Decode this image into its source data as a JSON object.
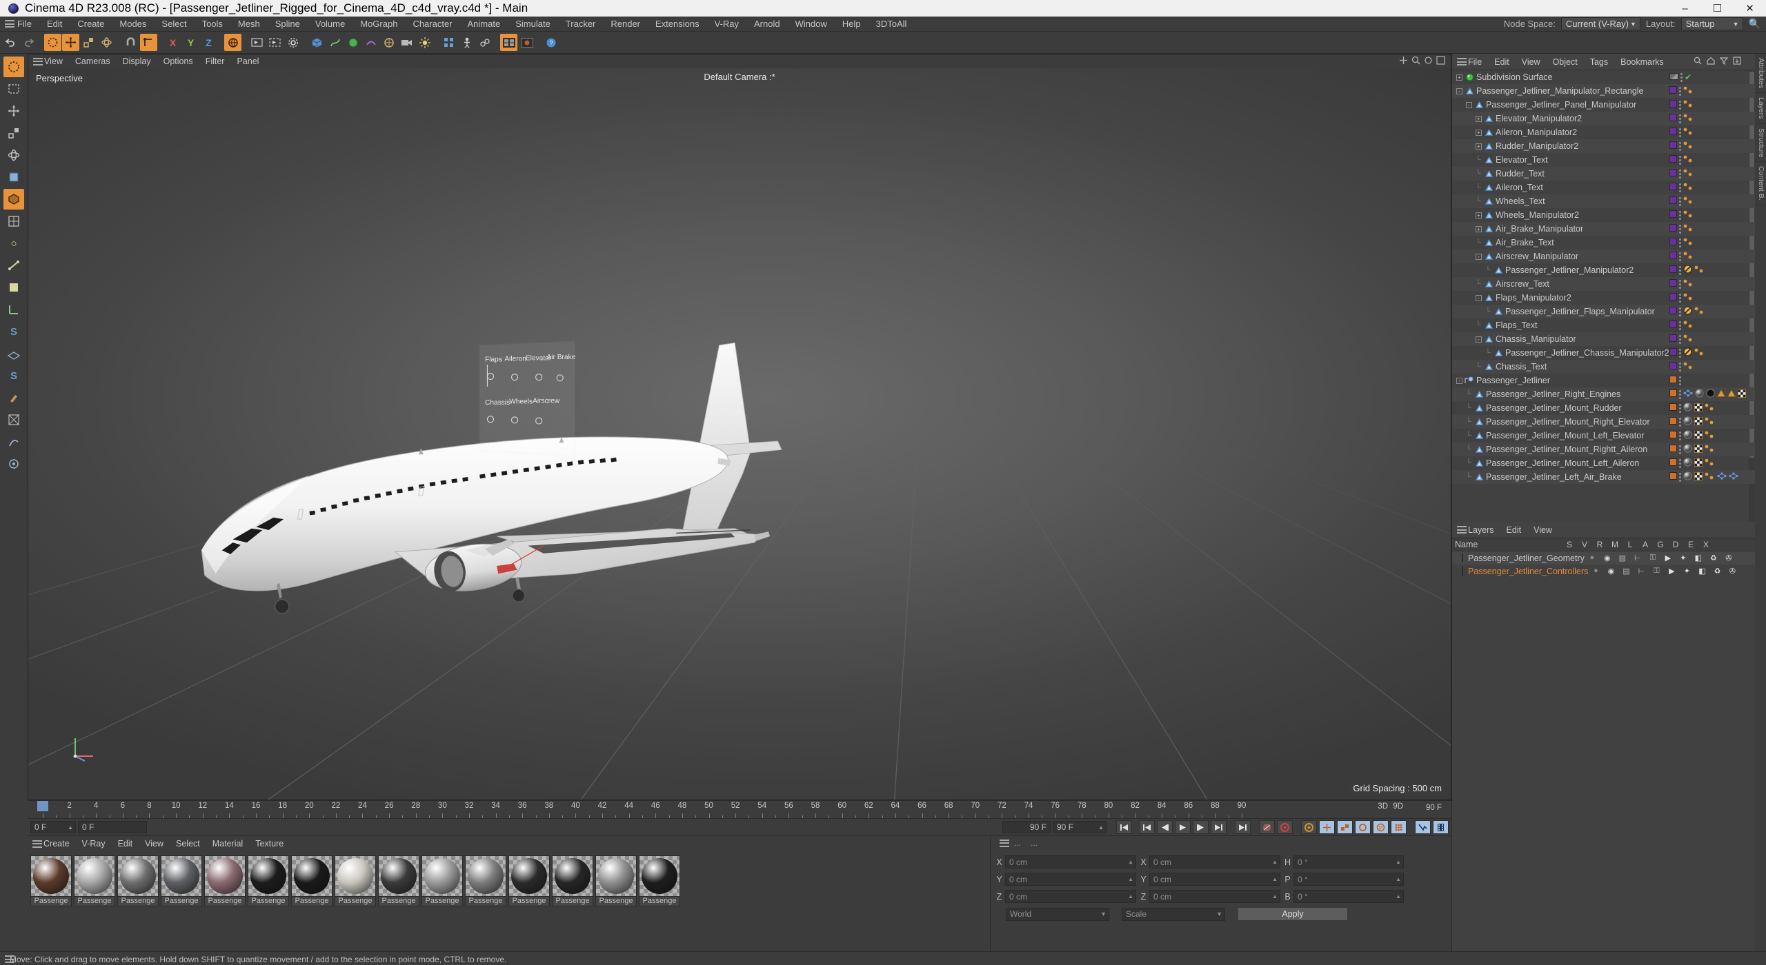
{
  "titlebar": {
    "title": "Cinema 4D R23.008 (RC) - [Passenger_Jetliner_Rigged_for_Cinema_4D_c4d_vray.c4d *] - Main",
    "minimize": "–",
    "maximize": "☐",
    "close": "✕"
  },
  "menubar": {
    "items": [
      "File",
      "Edit",
      "Create",
      "Modes",
      "Select",
      "Tools",
      "Mesh",
      "Spline",
      "Volume",
      "MoGraph",
      "Character",
      "Animate",
      "Simulate",
      "Tracker",
      "Render",
      "Extensions",
      "V-Ray",
      "Arnold",
      "Window",
      "Help",
      "3DToAll"
    ],
    "node_space_label": "Node Space:",
    "node_space_value": "Current (V-Ray)",
    "layout_label": "Layout:",
    "layout_value": "Startup"
  },
  "viewport": {
    "menu": [
      "View",
      "Cameras",
      "Display",
      "Options",
      "Filter",
      "Panel"
    ],
    "perspective_label": "Perspective",
    "camera_label": "Default Camera :*",
    "grid_spacing": "Grid Spacing : 500 cm",
    "axis_x": "X",
    "axis_y": "Y",
    "axis_z": "Z"
  },
  "object_manager": {
    "menu": [
      "File",
      "Edit",
      "View",
      "Object",
      "Tags",
      "Bookmarks"
    ],
    "items": [
      {
        "label": "Subdivision Surface",
        "depth": 0,
        "icon": "subdivision-surface-icon",
        "expander": "+",
        "tagcolor": "none",
        "tags": [
          "grey-bar",
          "dots",
          "green-check"
        ]
      },
      {
        "label": "Passenger_Jetliner_Manipulator_Rectangle",
        "depth": 0,
        "icon": "null-object-icon",
        "expander": "-",
        "tagcolor": "#6b2fa0",
        "tags": [
          "purple",
          "dots",
          "xpresso"
        ]
      },
      {
        "label": "Passenger_Jetliner_Panel_Manipulator",
        "depth": 1,
        "icon": "null-object-icon",
        "expander": "-",
        "tagcolor": "#6b2fa0",
        "tags": [
          "purple",
          "dots",
          "xpresso"
        ]
      },
      {
        "label": "Elevator_Manipulator2",
        "depth": 2,
        "icon": "null-object-icon",
        "expander": "+",
        "tagcolor": "#6b2fa0",
        "tags": [
          "purple",
          "dots",
          "xpresso"
        ]
      },
      {
        "label": "Aileron_Manipulator2",
        "depth": 2,
        "icon": "null-object-icon",
        "expander": "+",
        "tagcolor": "#6b2fa0",
        "tags": [
          "purple",
          "dots",
          "xpresso"
        ]
      },
      {
        "label": "Rudder_Manipulator2",
        "depth": 2,
        "icon": "null-object-icon",
        "expander": "+",
        "tagcolor": "#6b2fa0",
        "tags": [
          "purple",
          "dots",
          "xpresso"
        ]
      },
      {
        "label": "Elevator_Text",
        "depth": 2,
        "icon": "null-object-icon",
        "expander": "",
        "tagcolor": "#6b2fa0",
        "tags": [
          "purple",
          "dots",
          "xpresso"
        ]
      },
      {
        "label": "Rudder_Text",
        "depth": 2,
        "icon": "null-object-icon",
        "expander": "",
        "tagcolor": "#6b2fa0",
        "tags": [
          "purple",
          "dots",
          "xpresso"
        ]
      },
      {
        "label": "Aileron_Text",
        "depth": 2,
        "icon": "null-object-icon",
        "expander": "",
        "tagcolor": "#6b2fa0",
        "tags": [
          "purple",
          "dots",
          "xpresso"
        ]
      },
      {
        "label": "Wheels_Text",
        "depth": 2,
        "icon": "null-object-icon",
        "expander": "",
        "tagcolor": "#6b2fa0",
        "tags": [
          "purple",
          "dots",
          "xpresso"
        ]
      },
      {
        "label": "Wheels_Manipulator2",
        "depth": 2,
        "icon": "null-object-icon",
        "expander": "+",
        "tagcolor": "#6b2fa0",
        "tags": [
          "purple",
          "dots",
          "xpresso"
        ]
      },
      {
        "label": "Air_Brake_Manipulator",
        "depth": 2,
        "icon": "null-object-icon",
        "expander": "+",
        "tagcolor": "#6b2fa0",
        "tags": [
          "purple",
          "dots",
          "xpresso"
        ]
      },
      {
        "label": "Air_Brake_Text",
        "depth": 2,
        "icon": "null-object-icon",
        "expander": "",
        "tagcolor": "#6b2fa0",
        "tags": [
          "purple",
          "dots",
          "xpresso"
        ]
      },
      {
        "label": "Airscrew_Manipulator",
        "depth": 2,
        "icon": "null-object-icon",
        "expander": "-",
        "tagcolor": "#6b2fa0",
        "tags": [
          "purple",
          "dots",
          "xpresso"
        ]
      },
      {
        "label": "Passenger_Jetliner_Manipulator2",
        "depth": 3,
        "icon": "null-object-icon",
        "expander": "",
        "tagcolor": "#6b2fa0",
        "tags": [
          "purple",
          "dots",
          "noentry",
          "xpresso"
        ]
      },
      {
        "label": "Airscrew_Text",
        "depth": 2,
        "icon": "null-object-icon",
        "expander": "",
        "tagcolor": "#6b2fa0",
        "tags": [
          "purple",
          "dots",
          "xpresso"
        ]
      },
      {
        "label": "Flaps_Manipulator2",
        "depth": 2,
        "icon": "null-object-icon",
        "expander": "-",
        "tagcolor": "#6b2fa0",
        "tags": [
          "purple",
          "dots",
          "xpresso"
        ]
      },
      {
        "label": "Passenger_Jetliner_Flaps_Manipulator",
        "depth": 3,
        "icon": "null-object-icon",
        "expander": "",
        "tagcolor": "#6b2fa0",
        "tags": [
          "purple",
          "dots",
          "noentry",
          "xpresso"
        ]
      },
      {
        "label": "Flaps_Text",
        "depth": 2,
        "icon": "null-object-icon",
        "expander": "",
        "tagcolor": "#6b2fa0",
        "tags": [
          "purple",
          "dots",
          "xpresso"
        ]
      },
      {
        "label": "Chassis_Manipulator",
        "depth": 2,
        "icon": "null-object-icon",
        "expander": "-",
        "tagcolor": "#6b2fa0",
        "tags": [
          "purple",
          "dots",
          "xpresso"
        ]
      },
      {
        "label": "Passenger_Jetliner_Chassis_Manipulator2",
        "depth": 3,
        "icon": "null-object-icon",
        "expander": "",
        "tagcolor": "#6b2fa0",
        "tags": [
          "purple",
          "dots",
          "noentry",
          "xpresso"
        ]
      },
      {
        "label": "Chassis_Text",
        "depth": 2,
        "icon": "null-object-icon",
        "expander": "",
        "tagcolor": "#6b2fa0",
        "tags": [
          "purple",
          "dots",
          "xpresso"
        ]
      },
      {
        "label": "Passenger_Jetliner",
        "depth": 0,
        "icon": "group-object-icon",
        "expander": "-",
        "tagcolor": "#d2702a",
        "tags": [
          "orange",
          "dots"
        ]
      },
      {
        "label": "Passenger_Jetliner_Right_Engines",
        "depth": 1,
        "icon": "null-object-icon",
        "expander": "",
        "tagcolor": "#d2702a",
        "tags": [
          "orange",
          "dots",
          "point",
          "material",
          "material2",
          "tri",
          "tri",
          "uv"
        ]
      },
      {
        "label": "Passenger_Jetliner_Mount_Rudder",
        "depth": 1,
        "icon": "null-object-icon",
        "expander": "",
        "tagcolor": "#d2702a",
        "tags": [
          "orange",
          "dots",
          "material",
          "uv",
          "xpresso"
        ]
      },
      {
        "label": "Passenger_Jetliner_Mount_Right_Elevator",
        "depth": 1,
        "icon": "null-object-icon",
        "expander": "",
        "tagcolor": "#d2702a",
        "tags": [
          "orange",
          "dots",
          "material",
          "uv",
          "xpresso"
        ]
      },
      {
        "label": "Passenger_Jetliner_Mount_Left_Elevator",
        "depth": 1,
        "icon": "null-object-icon",
        "expander": "",
        "tagcolor": "#d2702a",
        "tags": [
          "orange",
          "dots",
          "material",
          "uv",
          "xpresso"
        ]
      },
      {
        "label": "Passenger_Jetliner_Mount_Rightt_Aileron",
        "depth": 1,
        "icon": "null-object-icon",
        "expander": "",
        "tagcolor": "#d2702a",
        "tags": [
          "orange",
          "dots",
          "material",
          "uv",
          "xpresso"
        ]
      },
      {
        "label": "Passenger_Jetliner_Mount_Left_Aileron",
        "depth": 1,
        "icon": "null-object-icon",
        "expander": "",
        "tagcolor": "#d2702a",
        "tags": [
          "orange",
          "dots",
          "material",
          "uv",
          "xpresso"
        ]
      },
      {
        "label": "Passenger_Jetliner_Left_Air_Brake",
        "depth": 1,
        "icon": "null-object-icon",
        "expander": "",
        "tagcolor": "#d2702a",
        "tags": [
          "orange",
          "dots",
          "material",
          "uv",
          "xpresso",
          "point",
          "point"
        ]
      }
    ]
  },
  "layers_panel": {
    "menu": [
      "Layers",
      "Edit",
      "View"
    ],
    "name_header": "Name",
    "columns": [
      "S",
      "V",
      "R",
      "M",
      "L",
      "A",
      "G",
      "D",
      "E",
      "X"
    ],
    "rows": [
      {
        "label": "Passenger_Jetliner_Geometry",
        "color": "#d2702a",
        "highlight": false
      },
      {
        "label": "Passenger_Jetliner_Controllers",
        "color": "#6b2fa0",
        "highlight": true
      }
    ]
  },
  "timeline": {
    "ticks": [
      0,
      2,
      4,
      6,
      8,
      10,
      12,
      14,
      16,
      18,
      20,
      22,
      24,
      26,
      28,
      30,
      32,
      34,
      36,
      38,
      40,
      42,
      44,
      46,
      48,
      50,
      52,
      54,
      56,
      58,
      60,
      62,
      64,
      66,
      68,
      70,
      72,
      74,
      76,
      78,
      80,
      82,
      84,
      86,
      88,
      90
    ],
    "start_frame": "0 F",
    "current_frame": "0 F",
    "end_frame_left": "90 F",
    "end_frame_right": "90 F",
    "preview_end": "90 F",
    "marker_3d": "3D",
    "marker_9d": "9D"
  },
  "material_manager": {
    "menu": [
      "Create",
      "V-Ray",
      "Edit",
      "View",
      "Select",
      "Material",
      "Texture"
    ],
    "materials": [
      {
        "name": "Passenge",
        "color": "#5b3a2a"
      },
      {
        "name": "Passenge",
        "color": "#a8a8a8"
      },
      {
        "name": "Passenge",
        "color": "#6e6e6e"
      },
      {
        "name": "Passenge",
        "color": "#5e6064"
      },
      {
        "name": "Passenge",
        "color": "#8a6a70"
      },
      {
        "name": "Passenge",
        "color": "#1c1c1c"
      },
      {
        "name": "Passenge",
        "color": "#1a1a1a"
      },
      {
        "name": "Passenge",
        "color": "#c9c6be"
      },
      {
        "name": "Passenge",
        "color": "#3a3a3a"
      },
      {
        "name": "Passenge",
        "color": "#9a9a9a"
      },
      {
        "name": "Passenge",
        "color": "#7d7d7d"
      },
      {
        "name": "Passenge",
        "color": "#2a2a2a"
      },
      {
        "name": "Passenge",
        "color": "#262626"
      },
      {
        "name": "Passenge",
        "color": "#8f8f8f"
      },
      {
        "name": "Passenge",
        "color": "#1e1e1e"
      }
    ]
  },
  "coordinates": {
    "position": {
      "x_label": "X",
      "y_label": "Y",
      "z_label": "Z",
      "x": "0 cm",
      "y": "0 cm",
      "z": "0 cm"
    },
    "size": {
      "x_label": "X",
      "y_label": "Y",
      "z_label": "Z",
      "x": "0 cm",
      "y": "0 cm",
      "z": "0 cm"
    },
    "rotation": {
      "h_label": "H",
      "p_label": "P",
      "b_label": "B",
      "h": "0 °",
      "p": "0 °",
      "b": "0 °"
    },
    "system": "World",
    "mode": "Scale",
    "apply": "Apply"
  },
  "statusbar": {
    "message": "Move: Click and drag to move elements. Hold down SHIFT to quantize movement / add to the selection in point mode, CTRL to remove."
  },
  "side_tabs": [
    "Attributes",
    "Layers",
    "Structure",
    "Content B."
  ],
  "colors": {
    "accent_orange": "#e7933c",
    "layer_purple": "#6b2fa0",
    "layer_orange": "#d2702a",
    "panel_bg": "#3c3c3c",
    "tree_bg": "#414141"
  }
}
